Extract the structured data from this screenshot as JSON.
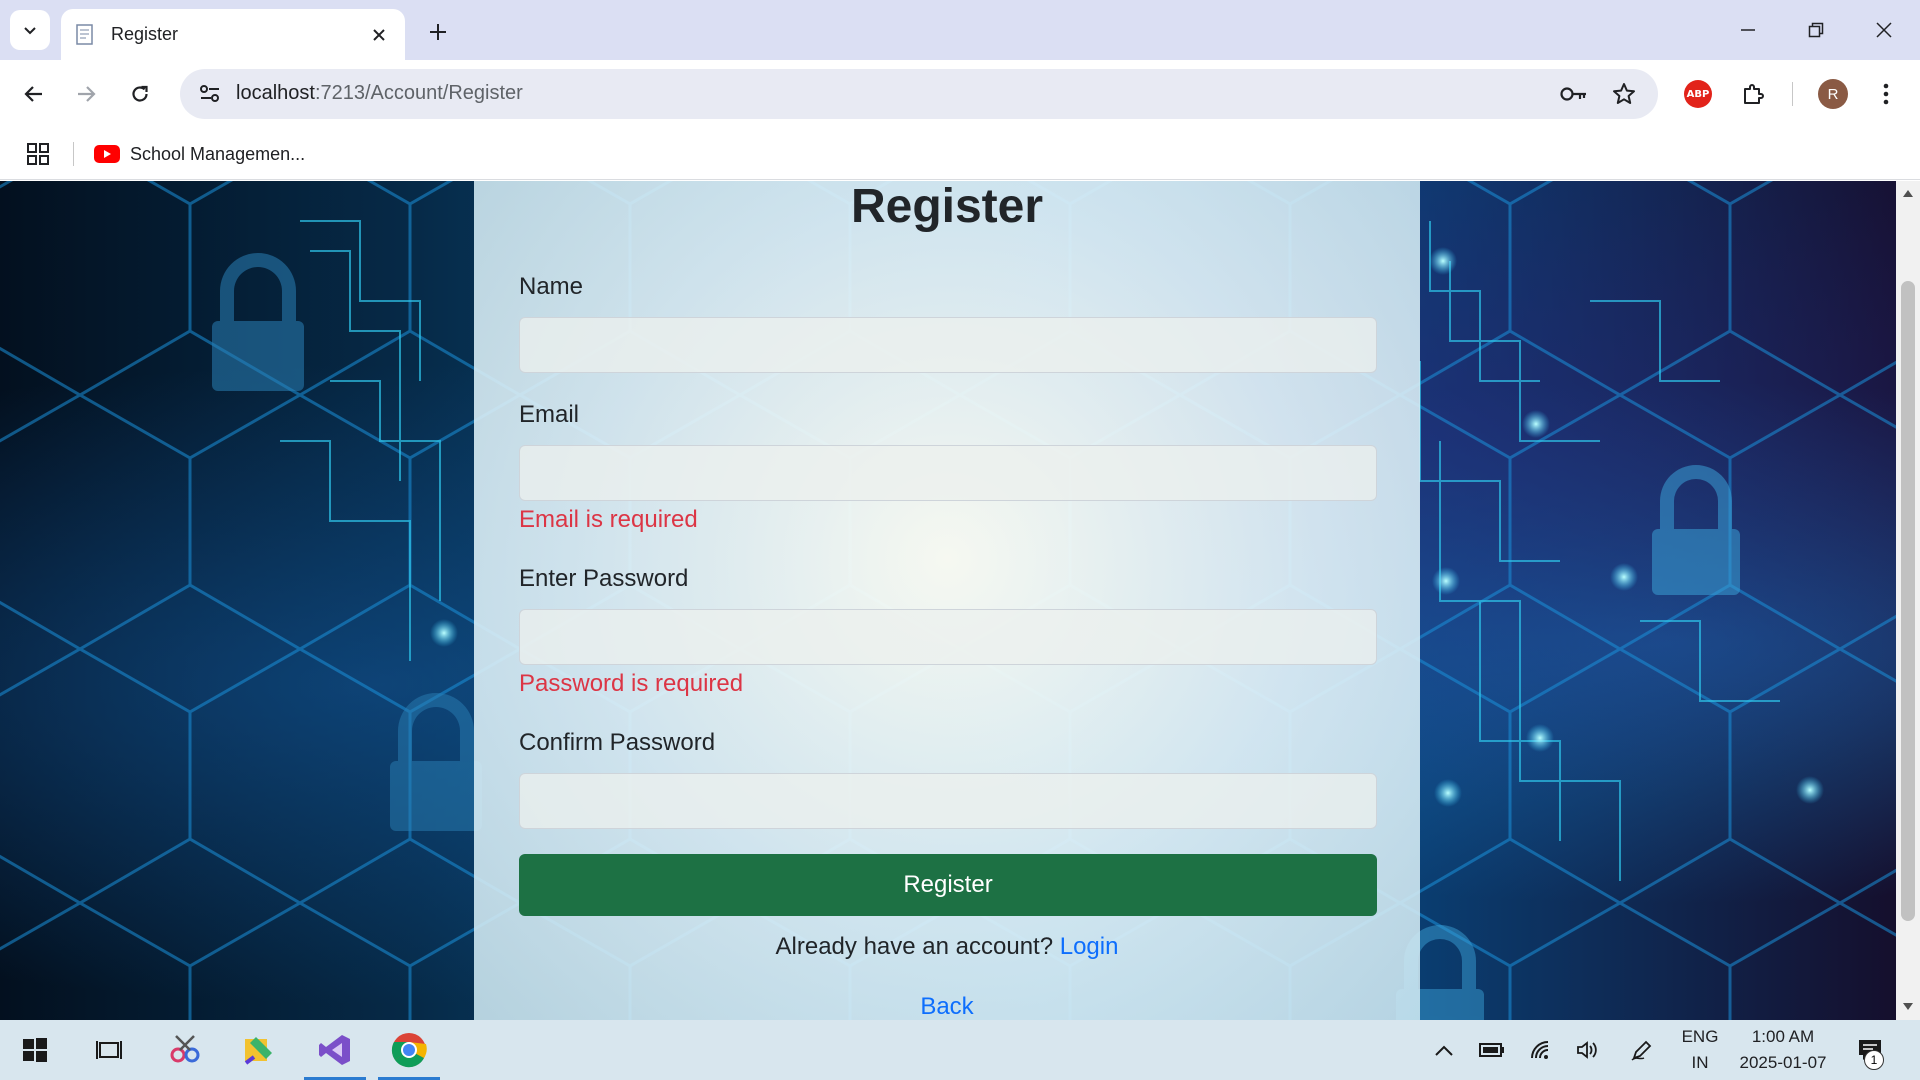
{
  "browser": {
    "tab_title": "Register",
    "url_host": "localhost",
    "url_path": ":7213/Account/Register",
    "bookmark_label": "School Managemen...",
    "profile_initial": "R",
    "abp_label": "ABP"
  },
  "form": {
    "title": "Register",
    "name_label": "Name",
    "email_label": "Email",
    "email_error": "Email is required",
    "password_label": "Enter Password",
    "password_error": "Password is required",
    "confirm_label": "Confirm Password",
    "submit_label": "Register",
    "login_prompt": "Already have an account?",
    "login_link": "Login",
    "back_link": "Back",
    "name_value": "",
    "email_value": "",
    "password_value": "",
    "confirm_value": ""
  },
  "taskbar": {
    "lang_top": "ENG",
    "lang_bottom": "IN",
    "time": "1:00 AM",
    "date": "2025-01-07",
    "notification_count": "1"
  },
  "colors": {
    "accent_green": "#1d7144",
    "error_red": "#dc3545",
    "link_blue": "#0d6efd",
    "tabstrip": "#dbdff3"
  },
  "icons": [
    "tab-list-icon",
    "page-favicon-icon",
    "close-icon",
    "plus-icon",
    "minimize-icon",
    "restore-icon",
    "back-arrow-icon",
    "forward-arrow-icon",
    "reload-icon",
    "site-info-icon",
    "key-icon",
    "star-icon",
    "puzzle-icon",
    "more-vert-icon",
    "apps-grid-icon",
    "youtube-icon",
    "windows-start-icon",
    "task-view-icon",
    "chrome-icon"
  ]
}
